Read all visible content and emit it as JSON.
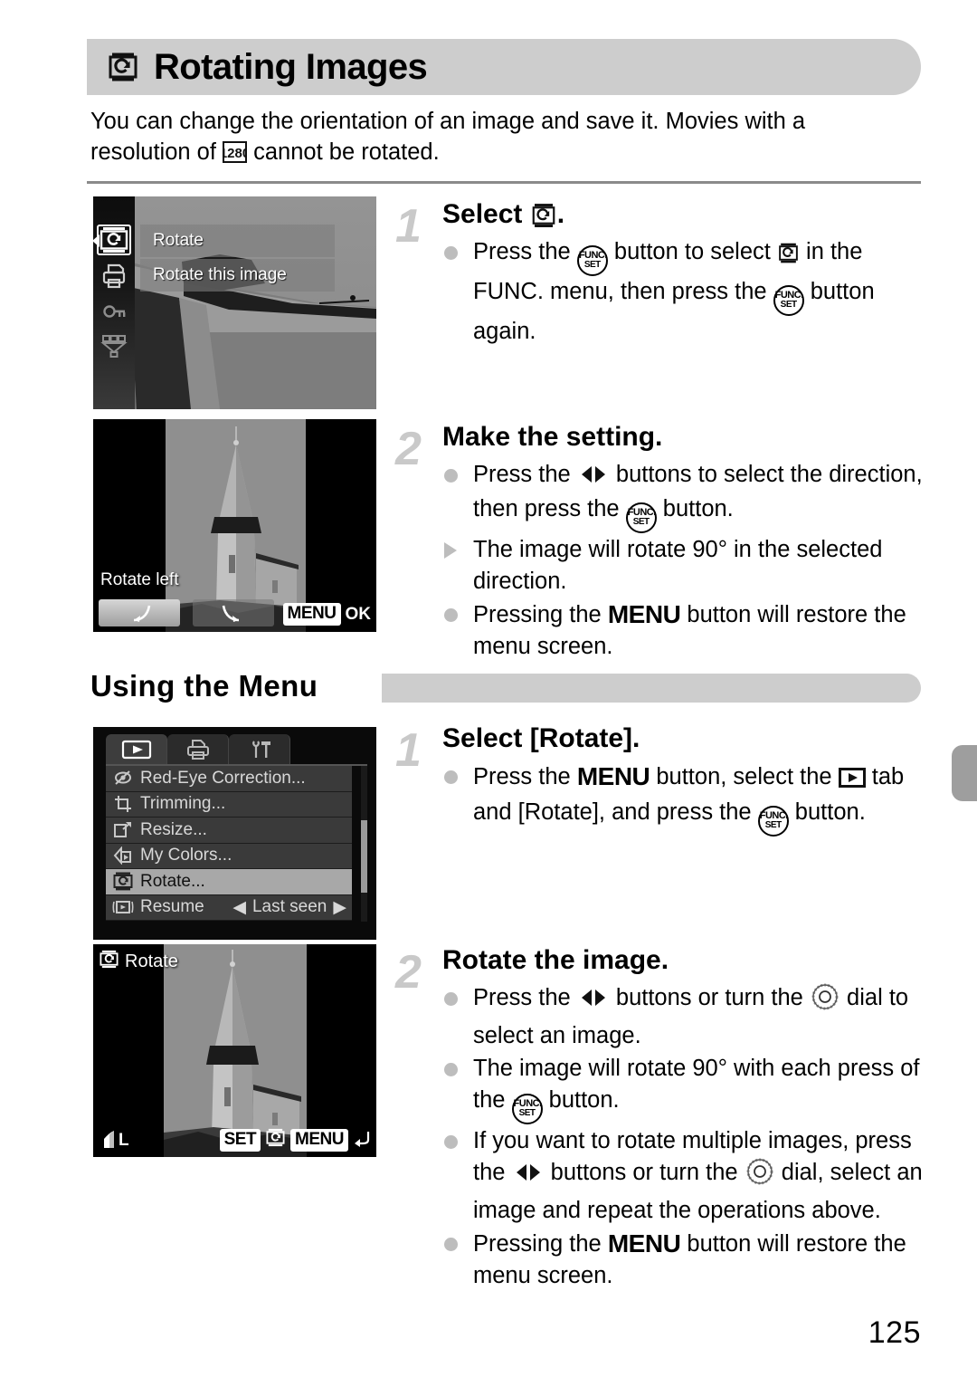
{
  "page": {
    "number": "125",
    "title": "Rotating Images",
    "title_icon": "rotate-icon",
    "intro_part1": "You can change the orientation of an image and save it. Movies with a",
    "intro_part2": "resolution of",
    "intro_icon": "movie-1280-icon",
    "intro_part3": "cannot be rotated."
  },
  "section": {
    "heading": "Using the Menu"
  },
  "steps": [
    {
      "number": "1",
      "heading_pre": "Select",
      "heading_icon": "rotate-icon",
      "heading_post": ".",
      "bullets": [
        {
          "marker": "dot",
          "parts": [
            {
              "t": "text",
              "v": "Press the "
            },
            {
              "t": "icon",
              "v": "func-set-button-icon"
            },
            {
              "t": "text",
              "v": " button to select "
            },
            {
              "t": "icon",
              "v": "rotate-icon"
            },
            {
              "t": "text",
              "v": " in the FUNC. menu, then press the "
            },
            {
              "t": "icon",
              "v": "func-set-button-icon"
            },
            {
              "t": "text",
              "v": " button again."
            }
          ]
        }
      ]
    },
    {
      "number": "2",
      "heading_pre": "Make the setting.",
      "bullets": [
        {
          "marker": "dot",
          "parts": [
            {
              "t": "text",
              "v": "Press the "
            },
            {
              "t": "icon",
              "v": "left-right-buttons-icon"
            },
            {
              "t": "text",
              "v": " buttons to select the direction, then press the "
            },
            {
              "t": "icon",
              "v": "func-set-button-icon"
            },
            {
              "t": "text",
              "v": " button."
            }
          ]
        },
        {
          "marker": "triangle",
          "parts": [
            {
              "t": "text",
              "v": "The image will rotate 90° in the selected direction."
            }
          ]
        },
        {
          "marker": "dot",
          "parts": [
            {
              "t": "text",
              "v": "Pressing the "
            },
            {
              "t": "menu",
              "v": "MENU"
            },
            {
              "t": "text",
              "v": " button will restore the menu screen."
            }
          ]
        }
      ]
    },
    {
      "number": "1",
      "heading_pre": "Select [Rotate].",
      "bullets": [
        {
          "marker": "dot",
          "parts": [
            {
              "t": "text",
              "v": "Press the "
            },
            {
              "t": "menu",
              "v": "MENU"
            },
            {
              "t": "text",
              "v": " button, select the "
            },
            {
              "t": "icon",
              "v": "playback-tab-icon"
            },
            {
              "t": "text",
              "v": " tab and [Rotate], and press the "
            },
            {
              "t": "icon",
              "v": "func-set-button-icon"
            },
            {
              "t": "text",
              "v": " button."
            }
          ]
        }
      ]
    },
    {
      "number": "2",
      "heading_pre": "Rotate the image.",
      "bullets": [
        {
          "marker": "dot",
          "parts": [
            {
              "t": "text",
              "v": "Press the "
            },
            {
              "t": "icon",
              "v": "left-right-buttons-icon"
            },
            {
              "t": "text",
              "v": " buttons or turn the "
            },
            {
              "t": "icon",
              "v": "control-dial-icon"
            },
            {
              "t": "text",
              "v": " dial to select an image."
            }
          ]
        },
        {
          "marker": "dot",
          "parts": [
            {
              "t": "text",
              "v": "The image will rotate 90° with each press of the "
            },
            {
              "t": "icon",
              "v": "func-set-button-icon"
            },
            {
              "t": "text",
              "v": " button."
            }
          ]
        },
        {
          "marker": "dot",
          "parts": [
            {
              "t": "text",
              "v": "If you want to rotate multiple images, press the "
            },
            {
              "t": "icon",
              "v": "left-right-buttons-icon"
            },
            {
              "t": "text",
              "v": " buttons or turn the "
            },
            {
              "t": "icon",
              "v": "control-dial-icon"
            },
            {
              "t": "text",
              "v": " dial, select an image and repeat the operations above."
            }
          ]
        },
        {
          "marker": "dot",
          "parts": [
            {
              "t": "text",
              "v": "Pressing the "
            },
            {
              "t": "menu",
              "v": "MENU"
            },
            {
              "t": "text",
              "v": " button will restore the menu screen."
            }
          ]
        }
      ]
    }
  ],
  "screenshots": {
    "func_menu": {
      "sidebar_icons": [
        "rotate-icon",
        "print-icon",
        "protect-key-icon",
        "category-icon"
      ],
      "selected_index": 0,
      "items": [
        {
          "label": "Rotate",
          "selected": true
        },
        {
          "label": "Rotate this image",
          "selected": false
        }
      ]
    },
    "rotate_left": {
      "label": "Rotate left",
      "button_left_icon": "rotate-left-arrow-icon",
      "button_right_icon": "rotate-right-arrow-icon",
      "selected_button": "left",
      "menu_badge": "MENU",
      "menu_action": "OK"
    },
    "playback_menu": {
      "tabs": [
        {
          "icon": "playback-tab-icon",
          "active": true
        },
        {
          "icon": "print-tab-icon",
          "active": false
        },
        {
          "icon": "settings-tab-icon",
          "active": false
        }
      ],
      "rows": [
        {
          "icon": "red-eye-icon",
          "label": "Red-Eye Correction...",
          "value": "",
          "highlighted": false
        },
        {
          "icon": "trimming-icon",
          "label": "Trimming...",
          "value": "",
          "highlighted": false
        },
        {
          "icon": "resize-icon",
          "label": "Resize...",
          "value": "",
          "highlighted": false
        },
        {
          "icon": "my-colors-icon",
          "label": "My Colors...",
          "value": "",
          "highlighted": false
        },
        {
          "icon": "rotate-icon",
          "label": "Rotate...",
          "value": "",
          "highlighted": true
        },
        {
          "icon": "resume-icon",
          "label": "Resume",
          "value": "Last seen",
          "highlighted": false
        }
      ]
    },
    "rotate_screen": {
      "title_icon": "rotate-icon",
      "title": "Rotate",
      "quality_badge": "L",
      "set_badge": "SET",
      "set_icon": "rotate-icon",
      "menu_badge": "MENU",
      "back_icon": "return-arrow-icon"
    }
  }
}
